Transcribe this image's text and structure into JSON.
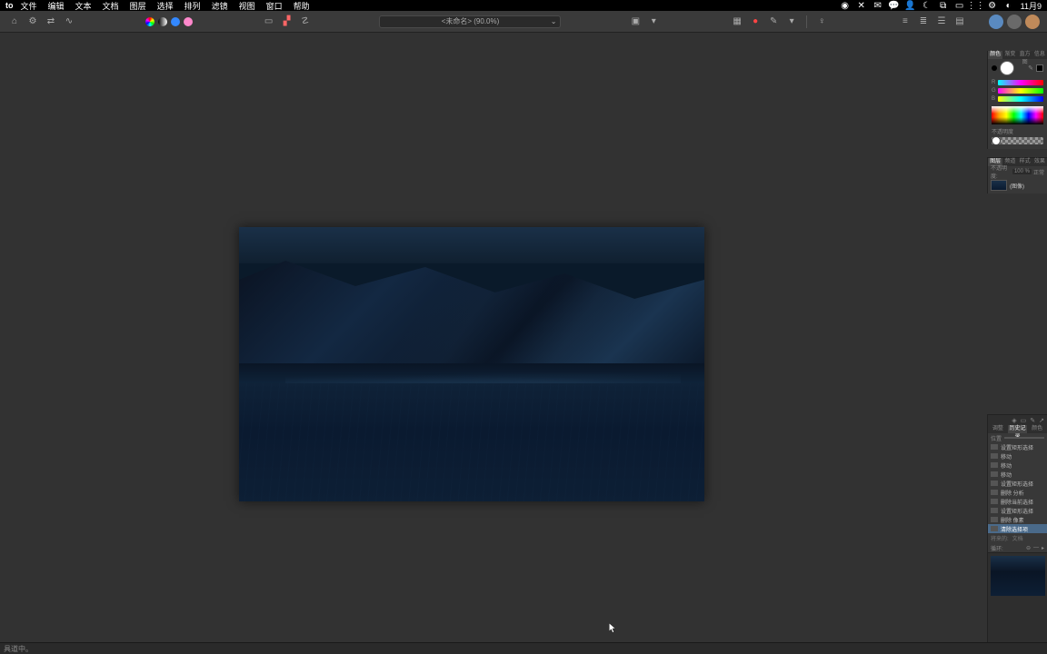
{
  "menu": {
    "app": "to",
    "items": [
      "文件",
      "编辑",
      "文本",
      "文档",
      "图层",
      "选择",
      "排列",
      "滤镜",
      "视图",
      "窗口",
      "帮助"
    ],
    "clock": "11月9"
  },
  "toolbar": {
    "doc_title": "<未命名> (90.0%)",
    "colors": {
      "chromatic": "#ff8800",
      "bw": "#888",
      "rgb1": "#3388ff",
      "rgb2": "#ff4488",
      "pink": "#ff88cc"
    }
  },
  "status": {
    "text": "具道中。"
  },
  "color_panel": {
    "tabs": [
      "颜色",
      "渐变",
      "直方图",
      "信息"
    ],
    "active_tab": 0,
    "opacity_label": "不透明度"
  },
  "layers_panel": {
    "tabs": [
      "图层",
      "频道",
      "样式",
      "效果"
    ],
    "active_tab": 0,
    "opacity_label": "不透明度:",
    "opacity_value": "100 %",
    "blend": "正常",
    "layer_name": "(图像)"
  },
  "history_panel": {
    "tabs": [
      "调整",
      "历史记录",
      "颜色"
    ],
    "active_tab": 1,
    "pos_label": "位置",
    "items": [
      "设置矩形选择",
      "移动",
      "移动",
      "移动",
      "设置矩形选择",
      "删除 分析",
      "删除当前选择",
      "设置矩形选择",
      "删除 像素",
      "清除选择项"
    ],
    "active_index": 9,
    "future_label": "将来的:",
    "future_value": "文档",
    "ctrl_label": "循环:"
  }
}
